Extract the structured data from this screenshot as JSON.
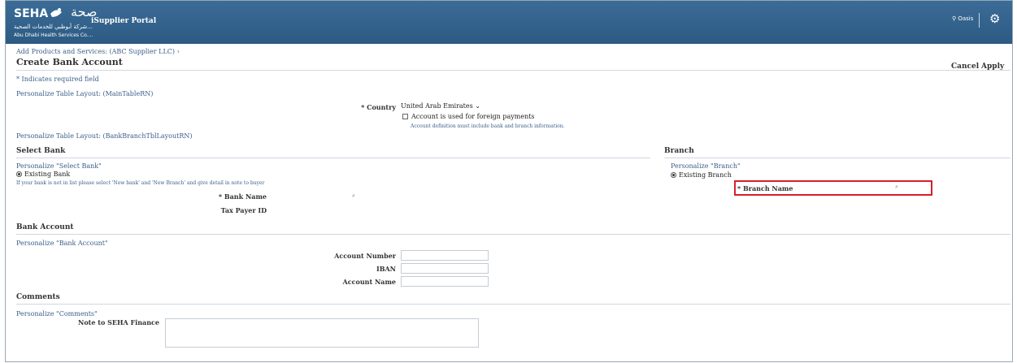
{
  "header": {
    "logo_en": "SEHA",
    "logo_ar": "صحة",
    "logo_sub_ar": "شركة أبوظبي للخدمات الصحية...",
    "logo_sub_en": "Abu Dhabi Health Services Co....",
    "portal_title": "iSupplier Portal",
    "user_label": "Oasis",
    "settings_icon": "gear-icon"
  },
  "breadcrumb": "Add Products and Services: (ABC Supplier LLC)",
  "breadcrumb_sep": "›",
  "page_title": "Create Bank Account",
  "buttons": {
    "cancel": "Cancel",
    "apply": "Apply"
  },
  "required_note": "* Indicates required field",
  "personalize": {
    "main_table": "Personalize Table Layout: (MainTableRN)",
    "bank_branch_table": "Personalize Table Layout: (BankBranchTblLayoutRN)",
    "select_bank": "Personalize \"Select Bank\"",
    "branch": "Personalize \"Branch\"",
    "bank_account": "Personalize \"Bank Account\"",
    "comments": "Personalize \"Comments\""
  },
  "country": {
    "label": "* Country",
    "value": "United Arab Emirates",
    "foreign_payments_label": "Account is used for foreign payments",
    "hint": "Account definition must include bank and branch information."
  },
  "sections": {
    "select_bank": "Select Bank",
    "branch": "Branch",
    "bank_account": "Bank Account",
    "comments": "Comments"
  },
  "bank": {
    "existing_label": "Existing Bank",
    "instruction": "If your bank is not in list please select 'New bank' and 'New Branch' and give detail in note to buyer",
    "name_label": "* Bank Name",
    "tax_payer_label": "Tax Payer ID"
  },
  "branch": {
    "existing_label": "Existing Branch",
    "name_label": "* Branch Name"
  },
  "account": {
    "number_label": "Account Number",
    "iban_label": "IBAN",
    "name_label": "Account Name"
  },
  "comments": {
    "note_label": "Note to SEHA Finance"
  },
  "colors": {
    "header": "#2c5a83",
    "highlight": "#d6202a",
    "link": "#3a5f8a"
  }
}
